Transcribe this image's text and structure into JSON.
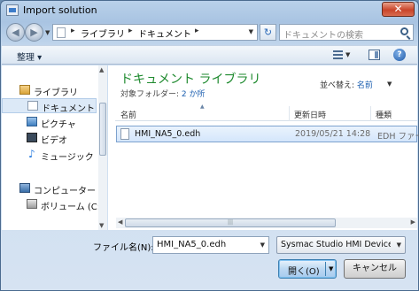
{
  "window": {
    "title": "Import solution",
    "close_label": "✕"
  },
  "nav": {
    "back_icon": "back-arrow-icon",
    "forward_icon": "forward-arrow-icon",
    "address": [
      "ライブラリ",
      "ドキュメント"
    ],
    "search_placeholder": "ドキュメントの検索"
  },
  "toolbar": {
    "organize_label": "整理 ▾"
  },
  "sidebar": {
    "items": [
      {
        "label": "ライブラリ",
        "icon": "library-icon"
      },
      {
        "label": "ドキュメント",
        "icon": "document-icon",
        "selected": true
      },
      {
        "label": "ピクチャ",
        "icon": "picture-icon"
      },
      {
        "label": "ビデオ",
        "icon": "video-icon"
      },
      {
        "label": "ミュージック",
        "icon": "music-icon"
      },
      {
        "label": "コンピューター",
        "icon": "computer-icon"
      },
      {
        "label": "ボリューム (C:",
        "icon": "volume-icon"
      }
    ]
  },
  "main": {
    "library_title": "ドキュメント ライブラリ",
    "target_label": "対象フォルダー:",
    "target_link": "2 か所",
    "arrange_label": "並べ替え:",
    "arrange_value": "名前",
    "columns": [
      "名前",
      "更新日時",
      "種類"
    ],
    "files": [
      {
        "name": "HMI_NA5_0.edh",
        "modified": "2019/05/21 14:28",
        "type": "EDH ファー"
      }
    ]
  },
  "footer": {
    "filename_label": "ファイル名(N):",
    "filename_value": "HMI_NA5_0.edh",
    "filter_value": "Sysmac Studio HMI Device I",
    "open_label": "開く(O)",
    "cancel_label": "キャンセル"
  },
  "colors": {
    "library_title": "#1e8a2e",
    "link": "#1c5fb0",
    "accent": "#3c7fb1"
  }
}
